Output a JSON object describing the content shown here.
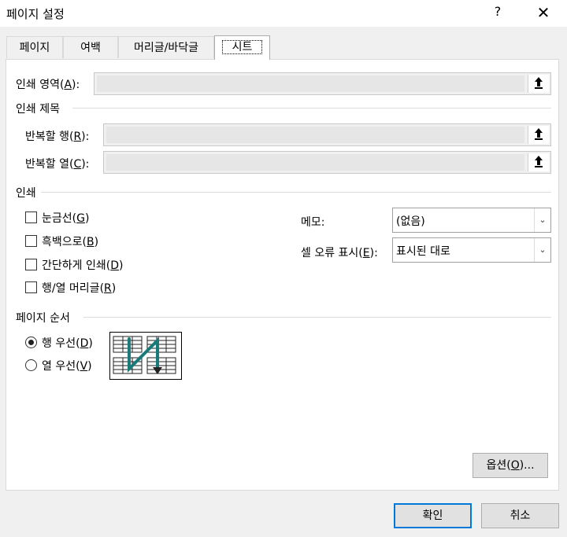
{
  "window": {
    "title": "페이지 설정",
    "help": "?",
    "close": "✕"
  },
  "tabs": [
    {
      "label": "페이지"
    },
    {
      "label": "여백"
    },
    {
      "label": "머리글/바닥글"
    },
    {
      "label": "시트",
      "active": true
    }
  ],
  "print_area": {
    "label": "인쇄 영역(",
    "key": "A",
    "suffix": "):",
    "value": ""
  },
  "print_titles": {
    "heading": "인쇄 제목",
    "rows": {
      "label": "반복할 행(",
      "key": "R",
      "suffix": "):",
      "value": ""
    },
    "cols": {
      "label": "반복할 열(",
      "key": "C",
      "suffix": "):",
      "value": ""
    }
  },
  "print": {
    "heading": "인쇄",
    "gridlines": {
      "label": "눈금선(",
      "key": "G",
      "suffix": ")",
      "checked": false
    },
    "bw": {
      "label": "흑백으로(",
      "key": "B",
      "suffix": ")",
      "checked": false
    },
    "draft": {
      "label": "간단하게 인쇄(",
      "key": "D",
      "suffix": ")",
      "checked": false
    },
    "headings": {
      "label": "행/열 머리글(",
      "key": "R",
      "suffix": ")",
      "checked": false
    },
    "comments": {
      "label": "메모:",
      "value": "(없음)"
    },
    "errors": {
      "label": "셀 오류 표시(",
      "key": "E",
      "suffix": "):",
      "value": "표시된 대로"
    }
  },
  "page_order": {
    "heading": "페이지 순서",
    "down_then_over": {
      "label": "행 우선(",
      "key": "D",
      "suffix": ")",
      "selected": true
    },
    "over_then_down": {
      "label": "열 우선(",
      "key": "V",
      "suffix": ")",
      "selected": false
    }
  },
  "buttons": {
    "options": {
      "label": "옵션(",
      "key": "O",
      "suffix": ")..."
    },
    "ok": "확인",
    "cancel": "취소"
  },
  "colors": {
    "accent": "#0078d7",
    "arrow": "#1a7a7a"
  }
}
